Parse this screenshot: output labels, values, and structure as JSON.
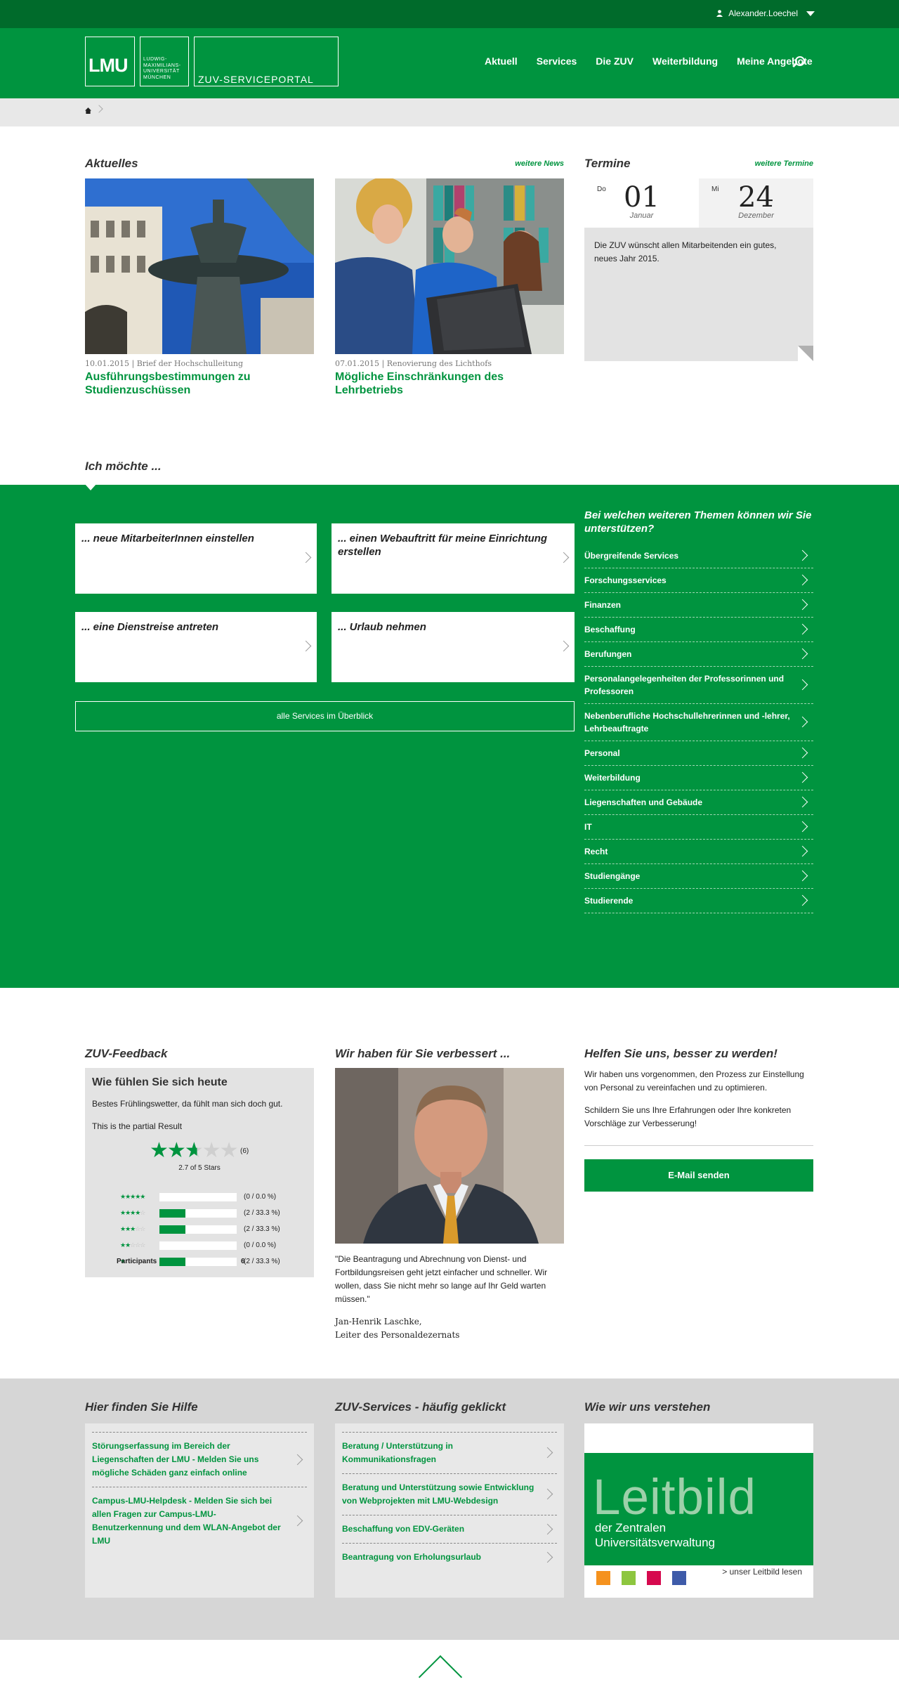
{
  "user": {
    "name": "Alexander.Loechel"
  },
  "logo": {
    "short": "LMU",
    "university_lines": [
      "LUDWIG-",
      "MAXIMILIANS-",
      "UNIVERSITÄT",
      "MÜNCHEN"
    ],
    "portal": "ZUV-SERVICEPORTAL"
  },
  "nav": {
    "items": [
      "Aktuell",
      "Services",
      "Die ZUV",
      "Weiterbildung",
      "Meine Angebote"
    ]
  },
  "news": {
    "title": "Aktuelles",
    "more": "weitere News",
    "items": [
      {
        "date": "10.01.2015",
        "category": "Brief der Hochschulleitung",
        "headline": "Ausführungsbestimmungen zu Studienzuschüssen"
      },
      {
        "date": "07.01.2015",
        "category": "Renovierung des Lichthofs",
        "headline": "Mögliche Einschränkungen des Lehrbetriebs"
      }
    ]
  },
  "events": {
    "title": "Termine",
    "more": "weitere Termine",
    "start": {
      "weekday": "Do",
      "day": "01",
      "month": "Januar"
    },
    "end": {
      "weekday": "Mi",
      "day": "24",
      "month": "Dezember"
    },
    "text": "Die ZUV wünscht allen Mitarbeitenden ein gutes, neues Jahr 2015."
  },
  "wish": {
    "title": "Ich möchte ...",
    "cards": [
      "... neue MitarbeiterInnen einstellen",
      "... einen Webauftritt für meine Einrichtung erstellen",
      "... eine Dienstreise antreten",
      "... Urlaub nehmen"
    ],
    "all_services": "alle Services im Überblick",
    "topics_head": "Bei welchen weiteren Themen können wir Sie unterstützen?",
    "topics": [
      "Übergreifende Services",
      "Forschungsservices",
      "Finanzen",
      "Beschaffung",
      "Berufungen",
      "Personalangelegenheiten der Professorinnen und Professoren",
      "Nebenberufliche Hochschullehrerinnen und -lehrer, Lehrbeauftragte",
      "Personal",
      "Weiterbildung",
      "Liegenschaften und Gebäude",
      "IT",
      "Recht",
      "Studiengänge",
      "Studierende"
    ]
  },
  "feedback": {
    "title": "ZUV-Feedback",
    "question": "Wie fühlen Sie sich heute",
    "answer": "Bestes Frühlingswetter, da fühlt man sich doch gut.",
    "partial": "This is the partial Result",
    "count": "(6)",
    "average": "2.7 of 5 Stars",
    "rating": 2.7,
    "rows": [
      {
        "stars": 5,
        "label": "(0 / 0.0 %)",
        "share": 0
      },
      {
        "stars": 4,
        "label": "(2 / 33.3 %)",
        "share": 0.333
      },
      {
        "stars": 3,
        "label": "(2 / 33.3 %)",
        "share": 0.333
      },
      {
        "stars": 2,
        "label": "(0 / 0.0 %)",
        "share": 0
      },
      {
        "stars": 1,
        "label": "(2 / 33.3 %)",
        "share": 0.333
      }
    ],
    "participants_label": "Participants",
    "participants": "6"
  },
  "improved": {
    "title": "Wir haben für Sie verbessert ...",
    "quote": "\"Die Beantragung und Abrechnung von Dienst- und Fortbildungsreisen geht jetzt einfacher und schneller. Wir wollen, dass Sie nicht mehr so lange auf Ihr Geld warten müssen.\"",
    "author": "Jan-Henrik Laschke,",
    "role": "Leiter des Personaldezernats"
  },
  "help": {
    "title": "Helfen Sie uns, besser zu werden!",
    "p1": "Wir haben uns vorgenommen, den Prozess zur Einstellung von Personal zu vereinfachen und zu optimieren.",
    "p2": "Schildern Sie uns Ihre Erfahrungen oder Ihre konkreten Vorschläge zur Verbesserung!",
    "button": "E-Mail senden"
  },
  "footer": {
    "help": {
      "title": "Hier finden Sie Hilfe",
      "links": [
        "Störungserfassung im Bereich der Liegenschaften der LMU - Melden Sie uns mögliche Schäden ganz einfach online",
        "Campus-LMU-Helpdesk - Melden Sie sich bei allen Fragen zur Campus-LMU-Benutzerkennung und dem WLAN-Angebot der LMU"
      ]
    },
    "services": {
      "title": "ZUV-Services - häufig geklickt",
      "links": [
        "Beratung / Unterstützung in Kommunikationsfragen",
        "Beratung und Unterstützung sowie Entwicklung von Webprojekten mit LMU-Webdesign",
        "Beschaffung von EDV-Geräten",
        "Beantragung von Erholungsurlaub"
      ]
    },
    "mission": {
      "title": "Wie wir uns verstehen",
      "big": "Leitbild",
      "sub1": "der Zentralen",
      "sub2": "Universitätsverwaltung",
      "link": "> unser Leitbild lesen",
      "colors": [
        "#f5921e",
        "#8dc63f",
        "#d6094e",
        "#3e5ba9"
      ]
    }
  },
  "colors": {
    "brand": "#00943f",
    "dark": "#006b2b"
  }
}
